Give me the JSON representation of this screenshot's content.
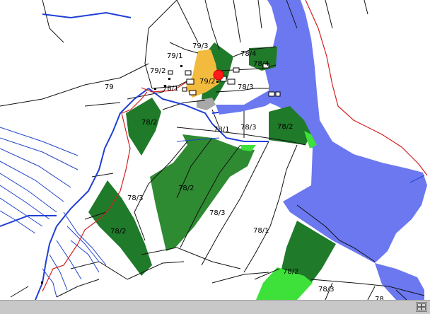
{
  "map": {
    "colors": {
      "background": "#ffffff",
      "parcel_border": "#111111",
      "forest_dark": "#1f7a2a",
      "forest_medium": "#2e8b32",
      "meadow_light": "#3ee03a",
      "farmyard": "#f2bb3e",
      "paved": "#a8a8a8",
      "water": "#6b78f0",
      "stream": "#1f3fd6",
      "road_red": "#d62020",
      "marker": "#ff1a1a"
    },
    "parcel_labels": [
      "79/3",
      "79/1",
      "79/2",
      "78/1",
      "79/2",
      "78/4",
      "78/4",
      "78/3",
      "79",
      "78/2",
      "78/1",
      "78/3",
      "78/2",
      "78/2",
      "78/3",
      "78/3",
      "78/2",
      "78/1",
      "78/2",
      "78/3",
      "78"
    ],
    "marker": {
      "type": "location-pin",
      "icon": "red-dot-icon"
    },
    "status_bar": {
      "icon": "grid-icon"
    }
  }
}
